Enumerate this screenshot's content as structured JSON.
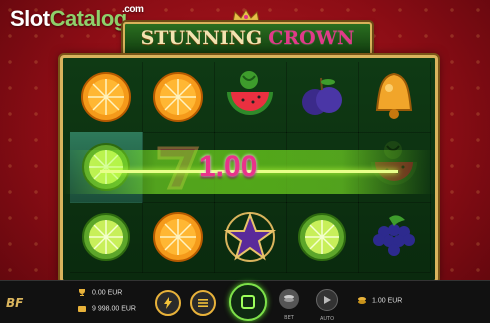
{
  "watermark": {
    "brand_a": "Slot",
    "brand_b": "Catalog",
    "suffix": ".com"
  },
  "game": {
    "title_a": "STUNNING",
    "title_b": "CROWN"
  },
  "reels": [
    [
      "orange",
      "lime",
      "lime"
    ],
    [
      "orange",
      "seven",
      "orange"
    ],
    [
      "watermelon",
      "blank",
      "star"
    ],
    [
      "plum",
      "blank",
      "lime"
    ],
    [
      "bell",
      "watermelon",
      "grapes"
    ]
  ],
  "win": {
    "amount": "1.00"
  },
  "footer": {
    "win_label": "0.00 EUR",
    "balance_label": "9 998.00 EUR",
    "bet_label": "1.00 EUR",
    "bet_button_caption": "BET",
    "auto_button_caption": "AUTO"
  },
  "colors": {
    "accent": "#e8338a",
    "gold": "#d9b45d",
    "win_line": "#9cff3a"
  }
}
